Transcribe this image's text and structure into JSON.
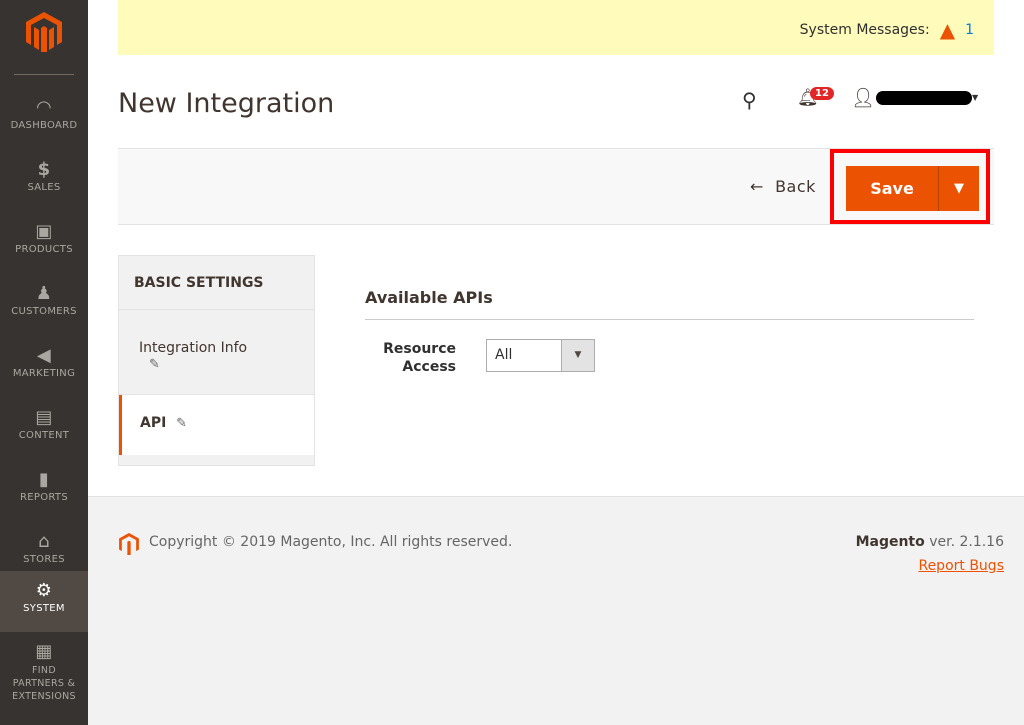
{
  "sidebar": {
    "items": [
      {
        "label": "DASHBOARD",
        "icon": "dashboard-icon"
      },
      {
        "label": "SALES",
        "icon": "dollar-icon"
      },
      {
        "label": "PRODUCTS",
        "icon": "box-icon"
      },
      {
        "label": "CUSTOMERS",
        "icon": "person-icon"
      },
      {
        "label": "MARKETING",
        "icon": "megaphone-icon"
      },
      {
        "label": "CONTENT",
        "icon": "layout-icon"
      },
      {
        "label": "REPORTS",
        "icon": "bar-chart-icon"
      },
      {
        "label": "STORES",
        "icon": "store-icon"
      },
      {
        "label": "SYSTEM",
        "icon": "gear-icon",
        "active": true
      },
      {
        "label": "FIND PARTNERS & EXTENSIONS",
        "icon": "lego-icon"
      }
    ]
  },
  "banner": {
    "label": "System Messages:",
    "count": "1"
  },
  "header": {
    "title": "New Integration",
    "notifications": "12"
  },
  "actions": {
    "back": "Back",
    "save": "Save"
  },
  "tabs": {
    "heading": "BASIC SETTINGS",
    "items": [
      {
        "label": "Integration Info"
      },
      {
        "label": "API",
        "active": true
      }
    ]
  },
  "form": {
    "section": "Available APIs",
    "resource_label": "Resource Access",
    "resource_value": "All"
  },
  "footer": {
    "copyright": "Copyright © 2019 Magento, Inc. All rights reserved.",
    "brand": "Magento",
    "version": " ver. 2.1.16",
    "report": "Report Bugs"
  },
  "colors": {
    "accent": "#eb5202",
    "sidebar": "#373330",
    "highlight": "#ff0000"
  }
}
